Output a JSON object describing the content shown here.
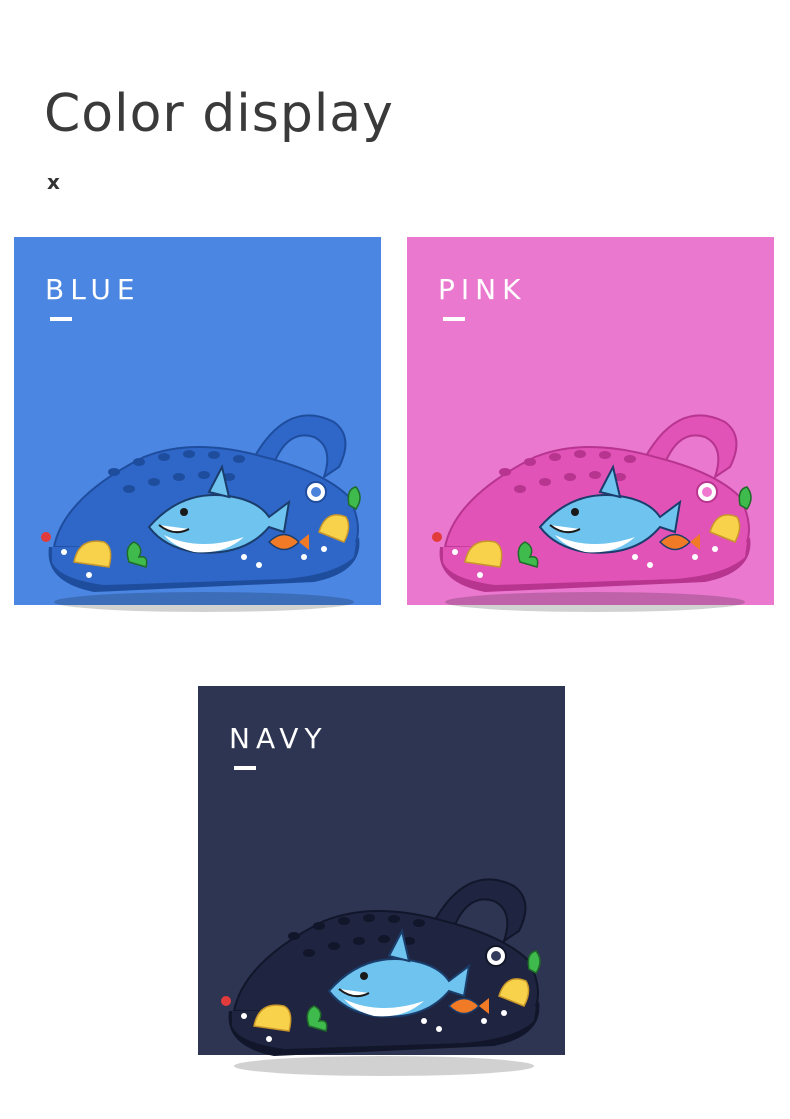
{
  "header": {
    "title": "Color display",
    "subtitle": "x"
  },
  "cards": [
    {
      "label": "BLUE",
      "bg": "#4a86e2",
      "shoe": "#2f67c9",
      "shoeDark": "#1f4d9e",
      "shoeLight": "#4b82dc"
    },
    {
      "label": "PINK",
      "bg": "#ea78cf",
      "shoe": "#e253b8",
      "shoeDark": "#b7348f",
      "shoeLight": "#ef7ad0"
    },
    {
      "label": "NAVY",
      "bg": "#2d3552",
      "shoe": "#1f2540",
      "shoeDark": "#12162a",
      "shoeLight": "#323a5c"
    }
  ]
}
